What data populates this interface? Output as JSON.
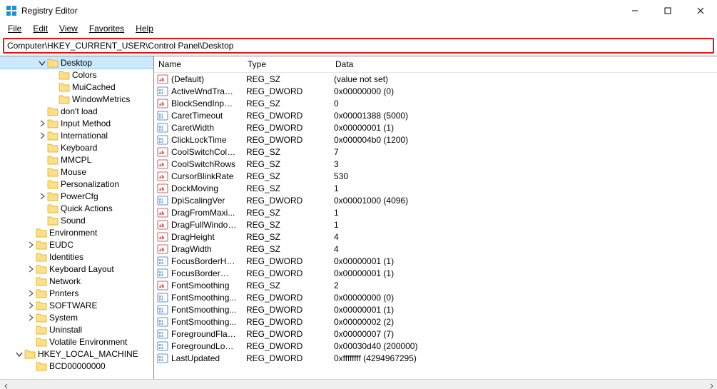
{
  "window": {
    "title": "Registry Editor"
  },
  "menu": {
    "file": "File",
    "edit": "Edit",
    "view": "View",
    "favorites": "Favorites",
    "help": "Help"
  },
  "path": "Computer\\HKEY_CURRENT_USER\\Control Panel\\Desktop",
  "headers": {
    "name": "Name",
    "type": "Type",
    "data": "Data"
  },
  "tree": [
    {
      "depth": 3,
      "expander": "open",
      "label": "Desktop",
      "selected": true
    },
    {
      "depth": 4,
      "expander": "none",
      "label": "Colors"
    },
    {
      "depth": 4,
      "expander": "none",
      "label": "MuiCached"
    },
    {
      "depth": 4,
      "expander": "none",
      "label": "WindowMetrics"
    },
    {
      "depth": 3,
      "expander": "none",
      "label": "don't load"
    },
    {
      "depth": 3,
      "expander": "closed",
      "label": "Input Method"
    },
    {
      "depth": 3,
      "expander": "closed",
      "label": "International"
    },
    {
      "depth": 3,
      "expander": "none",
      "label": "Keyboard"
    },
    {
      "depth": 3,
      "expander": "none",
      "label": "MMCPL"
    },
    {
      "depth": 3,
      "expander": "none",
      "label": "Mouse"
    },
    {
      "depth": 3,
      "expander": "none",
      "label": "Personalization"
    },
    {
      "depth": 3,
      "expander": "closed",
      "label": "PowerCfg"
    },
    {
      "depth": 3,
      "expander": "none",
      "label": "Quick Actions"
    },
    {
      "depth": 3,
      "expander": "none",
      "label": "Sound"
    },
    {
      "depth": 2,
      "expander": "none",
      "label": "Environment"
    },
    {
      "depth": 2,
      "expander": "closed",
      "label": "EUDC"
    },
    {
      "depth": 2,
      "expander": "none",
      "label": "Identities"
    },
    {
      "depth": 2,
      "expander": "closed",
      "label": "Keyboard Layout"
    },
    {
      "depth": 2,
      "expander": "none",
      "label": "Network"
    },
    {
      "depth": 2,
      "expander": "closed",
      "label": "Printers"
    },
    {
      "depth": 2,
      "expander": "closed",
      "label": "SOFTWARE"
    },
    {
      "depth": 2,
      "expander": "closed",
      "label": "System"
    },
    {
      "depth": 2,
      "expander": "none",
      "label": "Uninstall"
    },
    {
      "depth": 2,
      "expander": "none",
      "label": "Volatile Environment"
    },
    {
      "depth": 1,
      "expander": "open",
      "label": "HKEY_LOCAL_MACHINE"
    },
    {
      "depth": 2,
      "expander": "none",
      "label": "BCD00000000"
    }
  ],
  "values": [
    {
      "icon": "sz",
      "name": "(Default)",
      "type": "REG_SZ",
      "data": "(value not set)"
    },
    {
      "icon": "bin",
      "name": "ActiveWndTrack...",
      "type": "REG_DWORD",
      "data": "0x00000000 (0)"
    },
    {
      "icon": "sz",
      "name": "BlockSendInput...",
      "type": "REG_SZ",
      "data": "0"
    },
    {
      "icon": "bin",
      "name": "CaretTimeout",
      "type": "REG_DWORD",
      "data": "0x00001388 (5000)"
    },
    {
      "icon": "bin",
      "name": "CaretWidth",
      "type": "REG_DWORD",
      "data": "0x00000001 (1)"
    },
    {
      "icon": "bin",
      "name": "ClickLockTime",
      "type": "REG_DWORD",
      "data": "0x000004b0 (1200)"
    },
    {
      "icon": "sz",
      "name": "CoolSwitchColu...",
      "type": "REG_SZ",
      "data": "7"
    },
    {
      "icon": "sz",
      "name": "CoolSwitchRows",
      "type": "REG_SZ",
      "data": "3"
    },
    {
      "icon": "sz",
      "name": "CursorBlinkRate",
      "type": "REG_SZ",
      "data": "530"
    },
    {
      "icon": "sz",
      "name": "DockMoving",
      "type": "REG_SZ",
      "data": "1"
    },
    {
      "icon": "bin",
      "name": "DpiScalingVer",
      "type": "REG_DWORD",
      "data": "0x00001000 (4096)"
    },
    {
      "icon": "sz",
      "name": "DragFromMaxi...",
      "type": "REG_SZ",
      "data": "1"
    },
    {
      "icon": "sz",
      "name": "DragFullWindows",
      "type": "REG_SZ",
      "data": "1"
    },
    {
      "icon": "sz",
      "name": "DragHeight",
      "type": "REG_SZ",
      "data": "4"
    },
    {
      "icon": "sz",
      "name": "DragWidth",
      "type": "REG_SZ",
      "data": "4"
    },
    {
      "icon": "bin",
      "name": "FocusBorderHei...",
      "type": "REG_DWORD",
      "data": "0x00000001 (1)"
    },
    {
      "icon": "bin",
      "name": "FocusBorderWid...",
      "type": "REG_DWORD",
      "data": "0x00000001 (1)"
    },
    {
      "icon": "sz",
      "name": "FontSmoothing",
      "type": "REG_SZ",
      "data": "2"
    },
    {
      "icon": "bin",
      "name": "FontSmoothing...",
      "type": "REG_DWORD",
      "data": "0x00000000 (0)"
    },
    {
      "icon": "bin",
      "name": "FontSmoothing...",
      "type": "REG_DWORD",
      "data": "0x00000001 (1)"
    },
    {
      "icon": "bin",
      "name": "FontSmoothing...",
      "type": "REG_DWORD",
      "data": "0x00000002 (2)"
    },
    {
      "icon": "bin",
      "name": "ForegroundFlas...",
      "type": "REG_DWORD",
      "data": "0x00000007 (7)"
    },
    {
      "icon": "bin",
      "name": "ForegroundLock...",
      "type": "REG_DWORD",
      "data": "0x00030d40 (200000)"
    },
    {
      "icon": "bin",
      "name": "LastUpdated",
      "type": "REG_DWORD",
      "data": "0xffffffff (4294967295)"
    }
  ]
}
